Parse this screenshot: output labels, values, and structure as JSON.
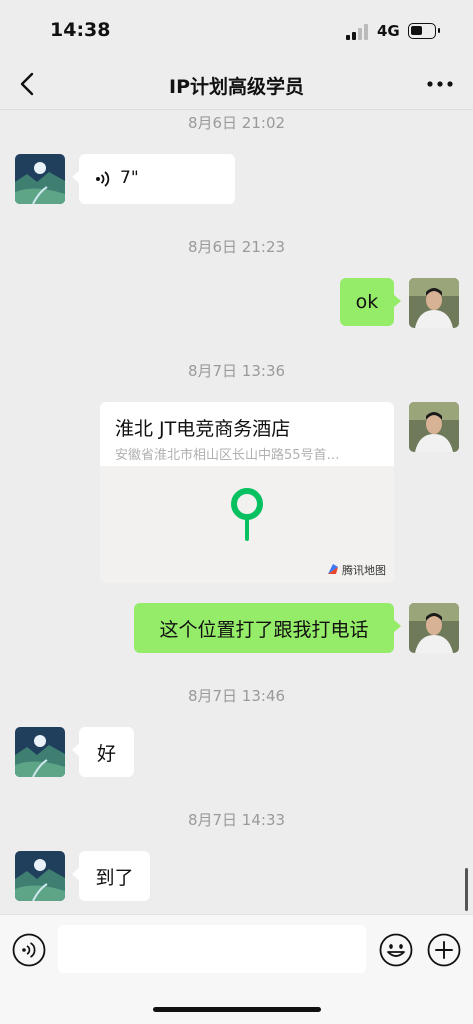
{
  "status_bar": {
    "time": "14:38",
    "network": "4G"
  },
  "header": {
    "title": "IP计划高级学员"
  },
  "messages": [
    {
      "timestamp": "8月6日 21:02",
      "text": "7\""
    },
    {
      "timestamp": "8月6日 21:23",
      "text": "ok"
    },
    {
      "timestamp": "8月7日 13:36",
      "location": {
        "name": "淮北 JT电竞商务酒店",
        "address": "安徽省淮北市相山区长山中路55号首…",
        "map_brand": "腾讯地图"
      }
    },
    {
      "text": "这个位置打了跟我打电话"
    },
    {
      "timestamp": "8月7日 13:46",
      "text": "好"
    },
    {
      "timestamp": "8月7日 14:33",
      "text": "到了"
    }
  ],
  "icons": {
    "back": "chevron-left-icon",
    "more": "more-dots-icon",
    "voice": "voice-wave-icon",
    "location_pin": "map-pin-icon",
    "emoji": "emoji-icon",
    "plus": "plus-icon"
  },
  "colors": {
    "background": "#ededed",
    "sent_bubble": "#95ec69",
    "received_bubble": "#ffffff",
    "pin": "#07c160"
  }
}
